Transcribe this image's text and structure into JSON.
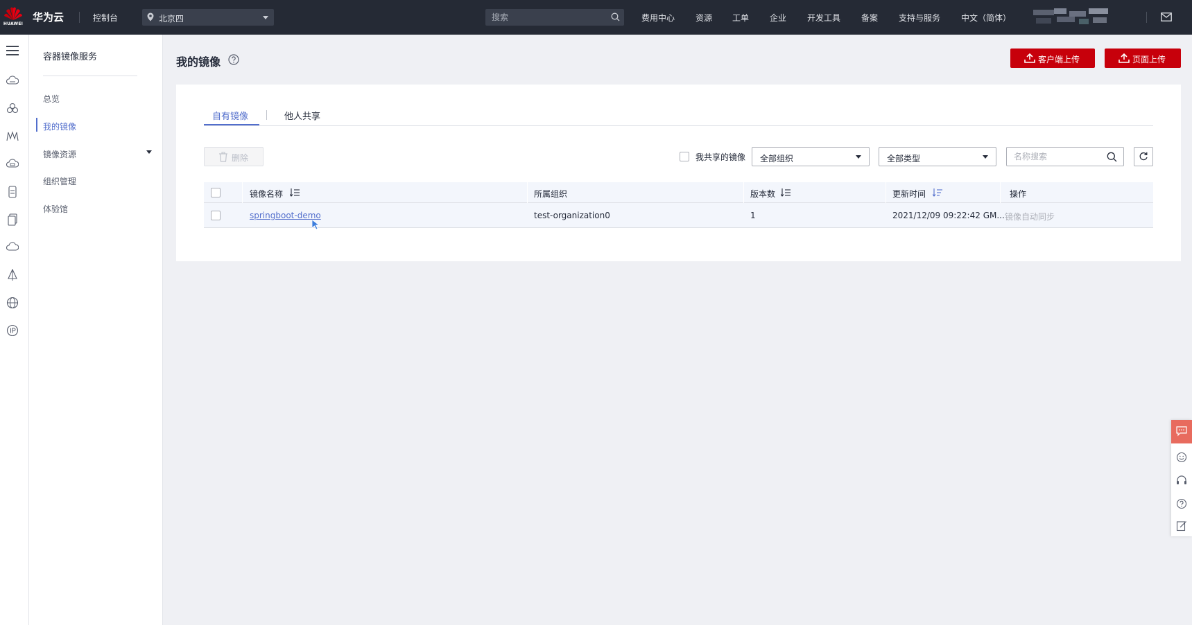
{
  "topbar": {
    "logo_text": "HUAWEI",
    "brand": "华为云",
    "console": "控制台",
    "region": "北京四",
    "search_placeholder": "搜索",
    "nav": [
      "费用中心",
      "资源",
      "工单",
      "企业",
      "开发工具",
      "备案",
      "支持与服务",
      "中文（简体）"
    ],
    "bg_color": "#252a35"
  },
  "sidebar": {
    "title": "容器镜像服务",
    "items": [
      {
        "label": "总览",
        "active": false
      },
      {
        "label": "我的镜像",
        "active": true
      },
      {
        "label": "镜像资源",
        "active": false,
        "has_submenu": true
      },
      {
        "label": "组织管理",
        "active": false
      },
      {
        "label": "体验馆",
        "active": false
      }
    ]
  },
  "main": {
    "title": "我的镜像",
    "client_upload": "客户端上传",
    "page_upload": "页面上传",
    "accent_color": "#c7000b"
  },
  "tabs": [
    {
      "label": "自有镜像",
      "active": true
    },
    {
      "label": "他人共享",
      "active": false
    }
  ],
  "toolbar": {
    "delete_label": "删除",
    "share_filter_label": "我共享的镜像",
    "org_select": "全部组织",
    "type_select": "全部类型",
    "name_search_placeholder": "名称搜索"
  },
  "table": {
    "columns": [
      "镜像名称",
      "所属组织",
      "版本数",
      "更新时间",
      "操作"
    ],
    "rows": [
      {
        "name": "springboot-demo",
        "organization": "test-organization0",
        "versions": "1",
        "updated": "2021/12/09 09:22:42 GM...",
        "action": "镜像自动同步"
      }
    ]
  },
  "link_color": "#526ecc"
}
